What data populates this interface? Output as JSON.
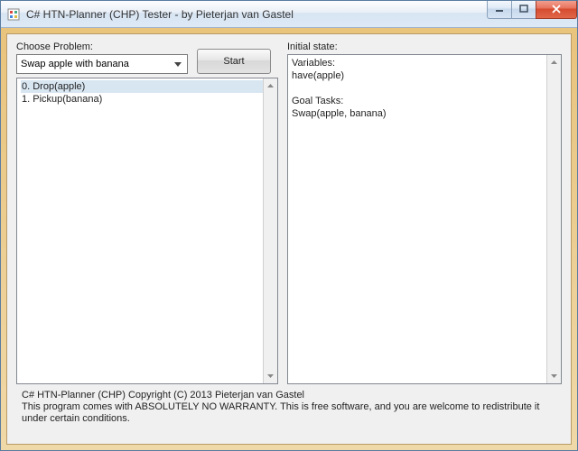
{
  "window": {
    "title": "C# HTN-Planner (CHP) Tester - by Pieterjan van Gastel"
  },
  "choose": {
    "label": "Choose Problem:",
    "selected": "Swap apple with banana"
  },
  "start": {
    "label": "Start"
  },
  "plan": {
    "items": [
      "0. Drop(apple)",
      "1. Pickup(banana)"
    ]
  },
  "initial": {
    "label": "Initial state:",
    "text": "Variables:\nhave(apple)\n\nGoal Tasks:\nSwap(apple, banana)"
  },
  "footer": {
    "line1": "C# HTN-Planner (CHP)  Copyright (C) 2013  Pieterjan van Gastel",
    "line2": "This program comes with ABSOLUTELY NO WARRANTY. This is free software, and you are welcome to redistribute it under certain conditions."
  }
}
